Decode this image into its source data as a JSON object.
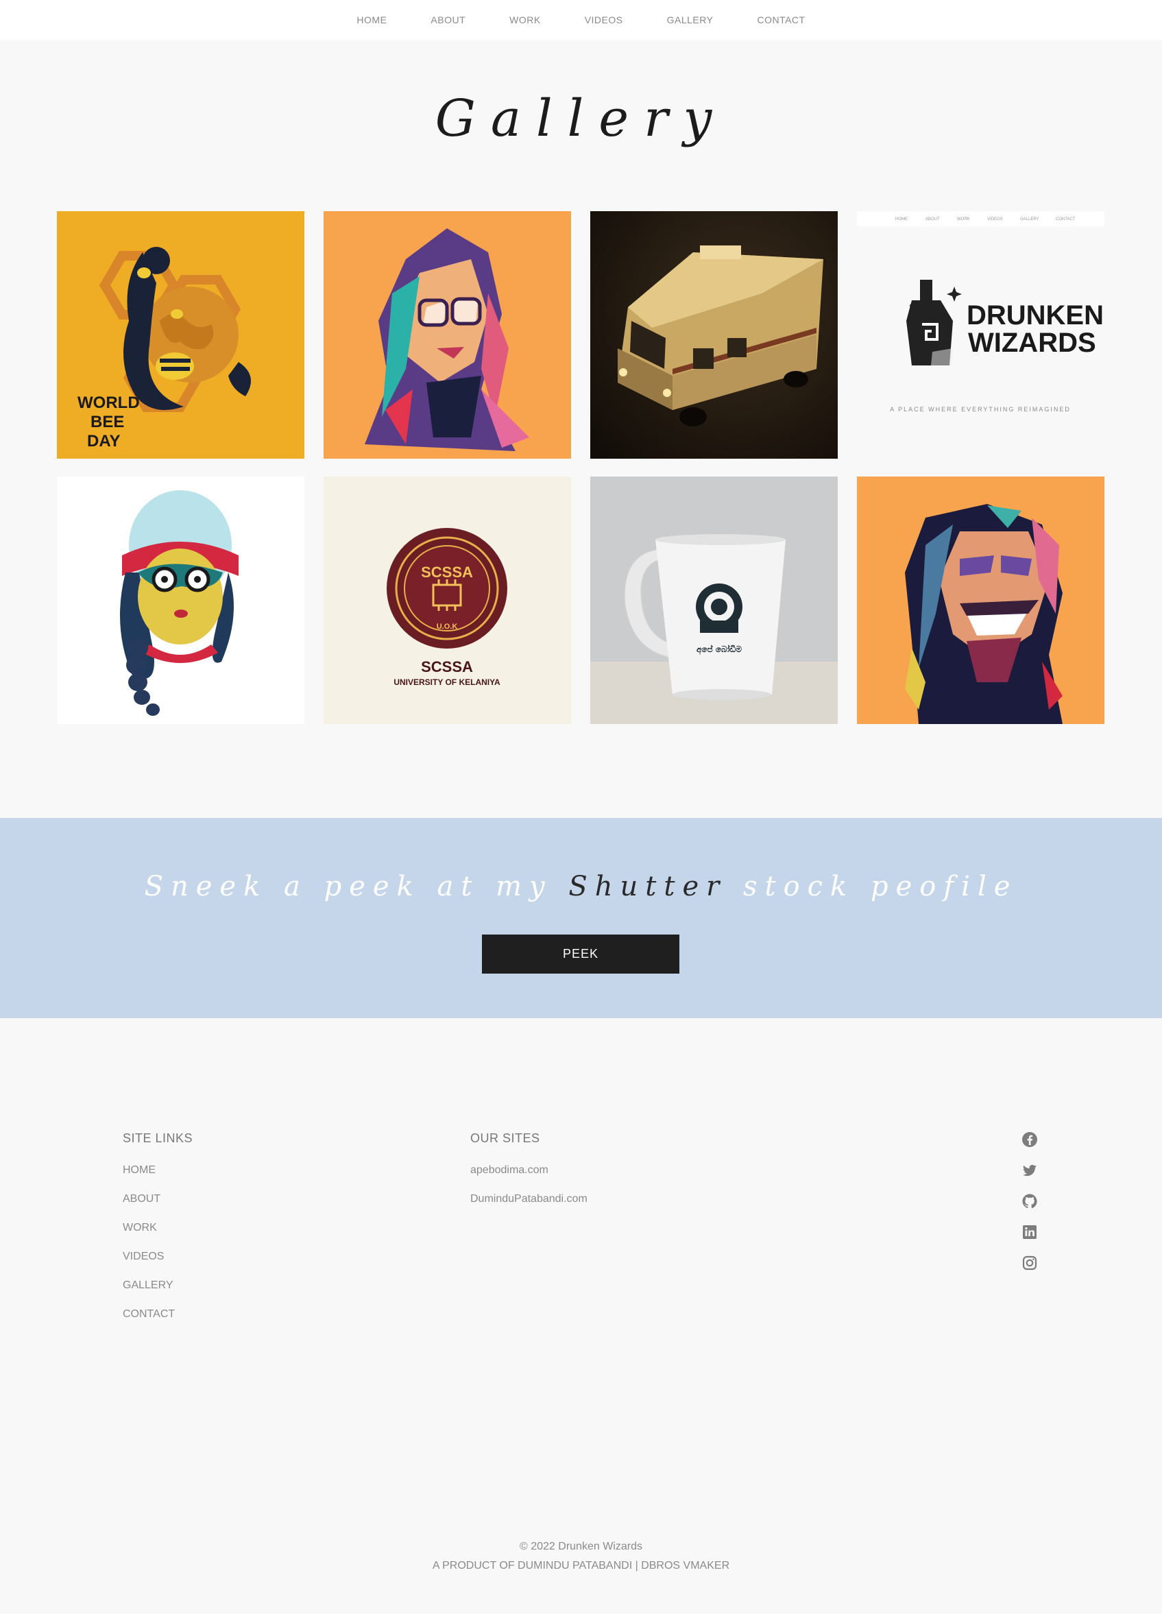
{
  "nav": {
    "items": [
      {
        "label": "HOME"
      },
      {
        "label": "ABOUT"
      },
      {
        "label": "WORK"
      },
      {
        "label": "VIDEOS"
      },
      {
        "label": "GALLERY"
      },
      {
        "label": "CONTACT"
      }
    ]
  },
  "gallery": {
    "title": "Gallery",
    "tiles": [
      {
        "name": "world-bee-day",
        "text_lines": [
          "WORLD",
          "BEE",
          "DAY"
        ],
        "bg": "#efad25"
      },
      {
        "name": "girl-wpap-portrait",
        "bg": "#f8a34d"
      },
      {
        "name": "rv-photo",
        "bg": "#1a140e"
      },
      {
        "name": "drunken-wizards-site",
        "brand_lines": [
          "DRUNKEN",
          "WIZARDS"
        ],
        "tagline": "A PLACE WHERE EVERYTHING REIMAGINED",
        "mini_nav": [
          "HOME",
          "ABOUT",
          "WORK",
          "VIDEOS",
          "GALLERY",
          "CONTACT"
        ],
        "bg": "#ffffff"
      },
      {
        "name": "girl-hat-illustration",
        "bg": "#ffffff"
      },
      {
        "name": "scssa-logo",
        "badge_text": "SCSSA",
        "badge_sub": "U.O.K",
        "title": "SCSSA",
        "subtitle": "UNIVERSITY OF KELANIYA",
        "bg": "#f5f1e5"
      },
      {
        "name": "apebodima-mug",
        "mug_text": "අපේ බෝඩිම",
        "bg": "#cbcccd"
      },
      {
        "name": "man-wpap-portrait",
        "bg": "#f8a34d"
      }
    ]
  },
  "banner": {
    "text_before": "Sneek a peek at my ",
    "text_dark": "Shutter",
    "text_after": " stock peofile",
    "button_label": "PEEK",
    "bg": "#c5d6eb"
  },
  "footer": {
    "site_links_title": "SITE LINKS",
    "site_links": [
      {
        "label": "HOME"
      },
      {
        "label": "ABOUT"
      },
      {
        "label": "WORK"
      },
      {
        "label": "VIDEOS"
      },
      {
        "label": "GALLERY"
      },
      {
        "label": "CONTACT"
      }
    ],
    "our_sites_title": "OUR SITES",
    "our_sites": [
      {
        "label": "apebodima.com"
      },
      {
        "label": "DuminduPatabandi.com"
      }
    ],
    "social_icons": [
      "facebook-icon",
      "twitter-icon",
      "github-icon",
      "linkedin-icon",
      "instagram-icon"
    ],
    "copyright": "© 2022 Drunken Wizards",
    "product_line": "A PRODUCT OF DUMINDU PATABANDI | DBROS VMAKER"
  }
}
